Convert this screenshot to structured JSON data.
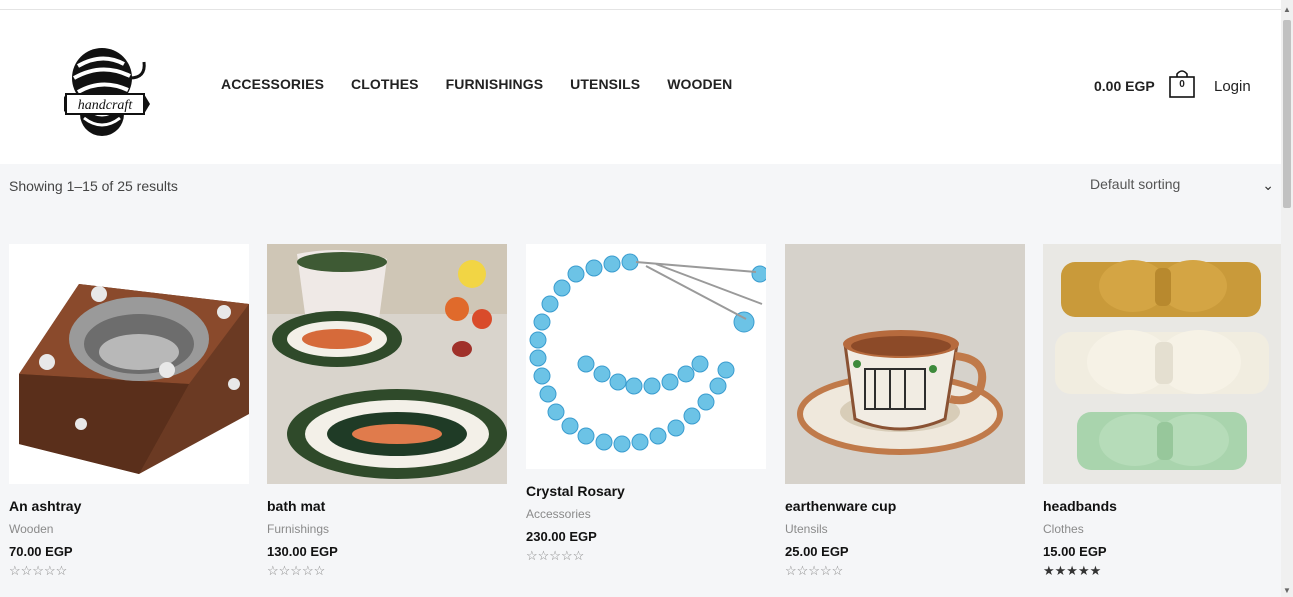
{
  "logo": {
    "text": "handcraft"
  },
  "nav": [
    "ACCESSORIES",
    "CLOTHES",
    "FURNISHINGS",
    "UTENSILS",
    "WOODEN"
  ],
  "cart": {
    "total": "0.00 EGP",
    "count": "0"
  },
  "login": "Login",
  "results_text": "Showing 1–15 of 25 results",
  "sorting": {
    "selected": "Default sorting"
  },
  "products": [
    {
      "name": "An ashtray",
      "category": "Wooden",
      "price": "70.00 EGP",
      "rating": 0,
      "image_icon": "ashtray-image"
    },
    {
      "name": "bath mat",
      "category": "Furnishings",
      "price": "130.00 EGP",
      "rating": 0,
      "image_icon": "bath-mat-image"
    },
    {
      "name": "Crystal Rosary",
      "category": "Accessories",
      "price": "230.00 EGP",
      "rating": 0,
      "image_icon": "rosary-image"
    },
    {
      "name": "earthenware cup",
      "category": "Utensils",
      "price": "25.00 EGP",
      "rating": 0,
      "image_icon": "cup-image"
    },
    {
      "name": "headbands",
      "category": "Clothes",
      "price": "15.00 EGP",
      "rating": 5,
      "image_icon": "headbands-image"
    }
  ],
  "stars": {
    "empty": "☆☆☆☆☆",
    "full": "★★★★★"
  },
  "colors": {
    "header_bg": "#ffffff",
    "page_bg": "#f5f6f8",
    "text": "#222222",
    "muted": "#8a8a8a"
  }
}
